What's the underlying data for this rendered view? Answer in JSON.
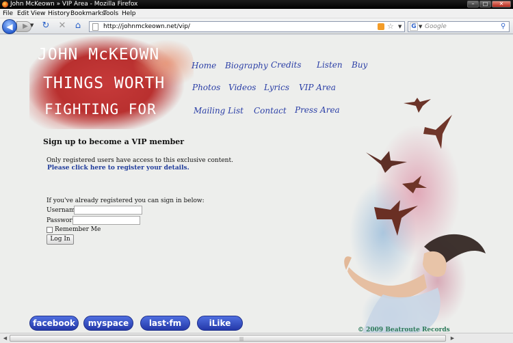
{
  "window": {
    "title": "John McKeown » VIP Area - Mozilla Firefox"
  },
  "menu": [
    "File",
    "Edit",
    "View",
    "History",
    "Bookmarks",
    "Tools",
    "Help"
  ],
  "toolbar": {
    "url": "http://johnmckeown.net/vip/",
    "search_placeholder": "Google"
  },
  "logo": {
    "line1": "JOHN McKEOWN",
    "line2": "THINGS WORTH",
    "line3": "FIGHTING FOR"
  },
  "nav": {
    "row1": [
      "Home",
      "Biography",
      "Credits",
      "Listen",
      "Buy"
    ],
    "row2": [
      "Photos",
      "Videos",
      "Lyrics",
      "VIP Area"
    ],
    "row3": [
      "Mailing List",
      "Contact",
      "Press Area"
    ]
  },
  "vip": {
    "title": "Sign up to become a VIP member",
    "intro": "Only registered users have access to this exclusive content.",
    "register_link": "Please click here to register your details.",
    "already": "If you've already registered you can sign in below:",
    "username_label": "Username",
    "password_label": "Password",
    "remember_label": "Remember Me",
    "login_button": "Log In"
  },
  "social": [
    "facebook",
    "myspace",
    "last·fm",
    "iLike"
  ],
  "footer": {
    "copyright": "© 2009 Beatroute Records"
  }
}
